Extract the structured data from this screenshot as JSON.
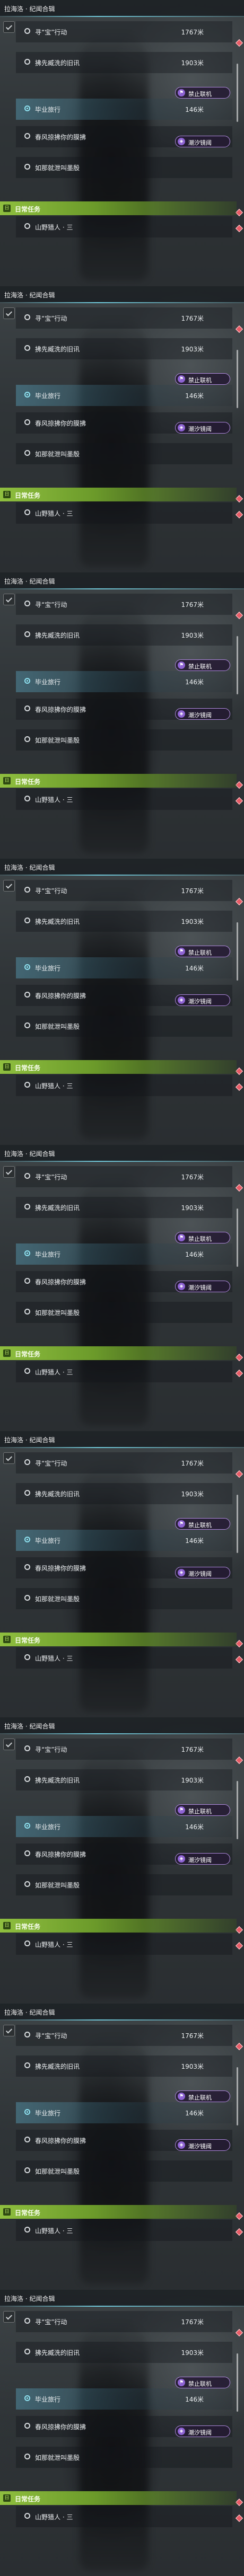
{
  "screen_count": 9,
  "panel": {
    "title": "拉海洛 · 纪闻合辑",
    "quests": [
      {
        "label": "寻“宝”行动",
        "distance": "1767米",
        "active": false
      },
      {
        "label": "拂先臧洗的旧讯",
        "distance": "1903米",
        "active": false
      },
      {
        "label": "毕业旅行",
        "distance": "146米",
        "active": true
      },
      {
        "label": "春风掠拂你的膜拂",
        "distance": "",
        "active": false
      },
      {
        "label": "如那就泄叫墨殷",
        "distance": "",
        "active": false
      }
    ],
    "tags": [
      {
        "label": "禁止联机",
        "icon": "no-multiplayer-icon"
      },
      {
        "label": "潮汐镜阈",
        "icon": "tide-domain-icon"
      }
    ],
    "daily_section": {
      "badge": "日",
      "label": "日常任务"
    },
    "daily_items": [
      {
        "label": "山野猎人 · 三"
      }
    ]
  },
  "colors": {
    "accent_teal": "#70c8d9",
    "active_radio": "#8fe3f2",
    "tag_border": "#b08adf",
    "tag_icon": "#8e63d3",
    "daily_green": "#8fbf3f",
    "marker_red": "#e85b66"
  }
}
